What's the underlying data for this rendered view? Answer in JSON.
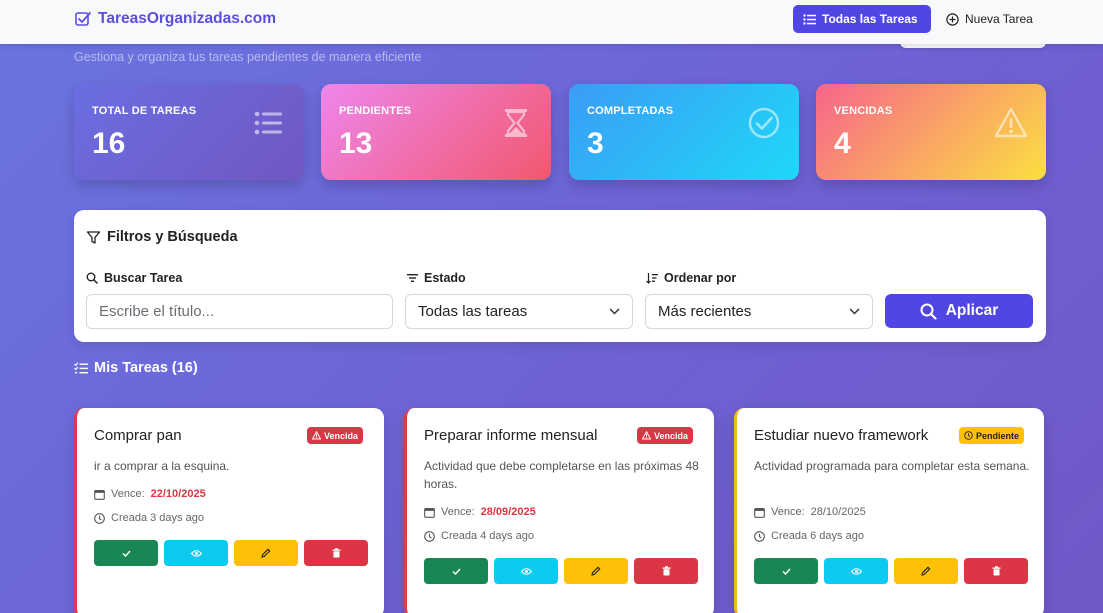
{
  "brand": {
    "name": "TareasOrganizadas.com",
    "icon": "checkbox-icon"
  },
  "nav": {
    "all_tasks": "Todas las Tareas",
    "new_task": "Nueva Tarea"
  },
  "header": {
    "subtitle": "Gestiona y organiza tus tareas pendientes de manera eficiente"
  },
  "stats": [
    {
      "label": "TOTAL DE TAREAS",
      "value": "16",
      "icon": "list-icon"
    },
    {
      "label": "PENDIENTES",
      "value": "13",
      "icon": "hourglass-icon"
    },
    {
      "label": "COMPLETADAS",
      "value": "3",
      "icon": "check-circle-icon"
    },
    {
      "label": "VENCIDAS",
      "value": "4",
      "icon": "warning-icon"
    }
  ],
  "filters": {
    "title": "Filtros y Búsqueda",
    "search_label": "Buscar Tarea",
    "search_placeholder": "Escribe el título...",
    "status_label": "Estado",
    "status_value": "Todas las tareas",
    "sort_label": "Ordenar por",
    "sort_value": "Más recientes",
    "apply": "Aplicar"
  },
  "tasks_section": {
    "title": "Mis Tareas (16)"
  },
  "tasks": [
    {
      "title": "Comprar pan",
      "badge": "Vencida",
      "description": "ir a comprar a la esquina.",
      "due_label": "Vence:",
      "due": "22/10/2025",
      "created": "Creada 3 days ago"
    },
    {
      "title": "Preparar informe mensual",
      "badge": "Vencida",
      "description": "Actividad que debe completarse en las próximas 48 horas.",
      "due_label": "Vence:",
      "due": "28/09/2025",
      "created": "Creada 4 days ago"
    },
    {
      "title": "Estudiar nuevo framework",
      "badge": "Pendiente",
      "description": "Actividad programada para completar esta semana.",
      "due_label": "Vence:",
      "due": "28/10/2025",
      "created": "Creada 6 days ago"
    }
  ],
  "colors": {
    "accent": "#5046e4",
    "danger": "#dc3545",
    "warning": "#ffc107",
    "success": "#198754",
    "info": "#0dcaf0"
  }
}
